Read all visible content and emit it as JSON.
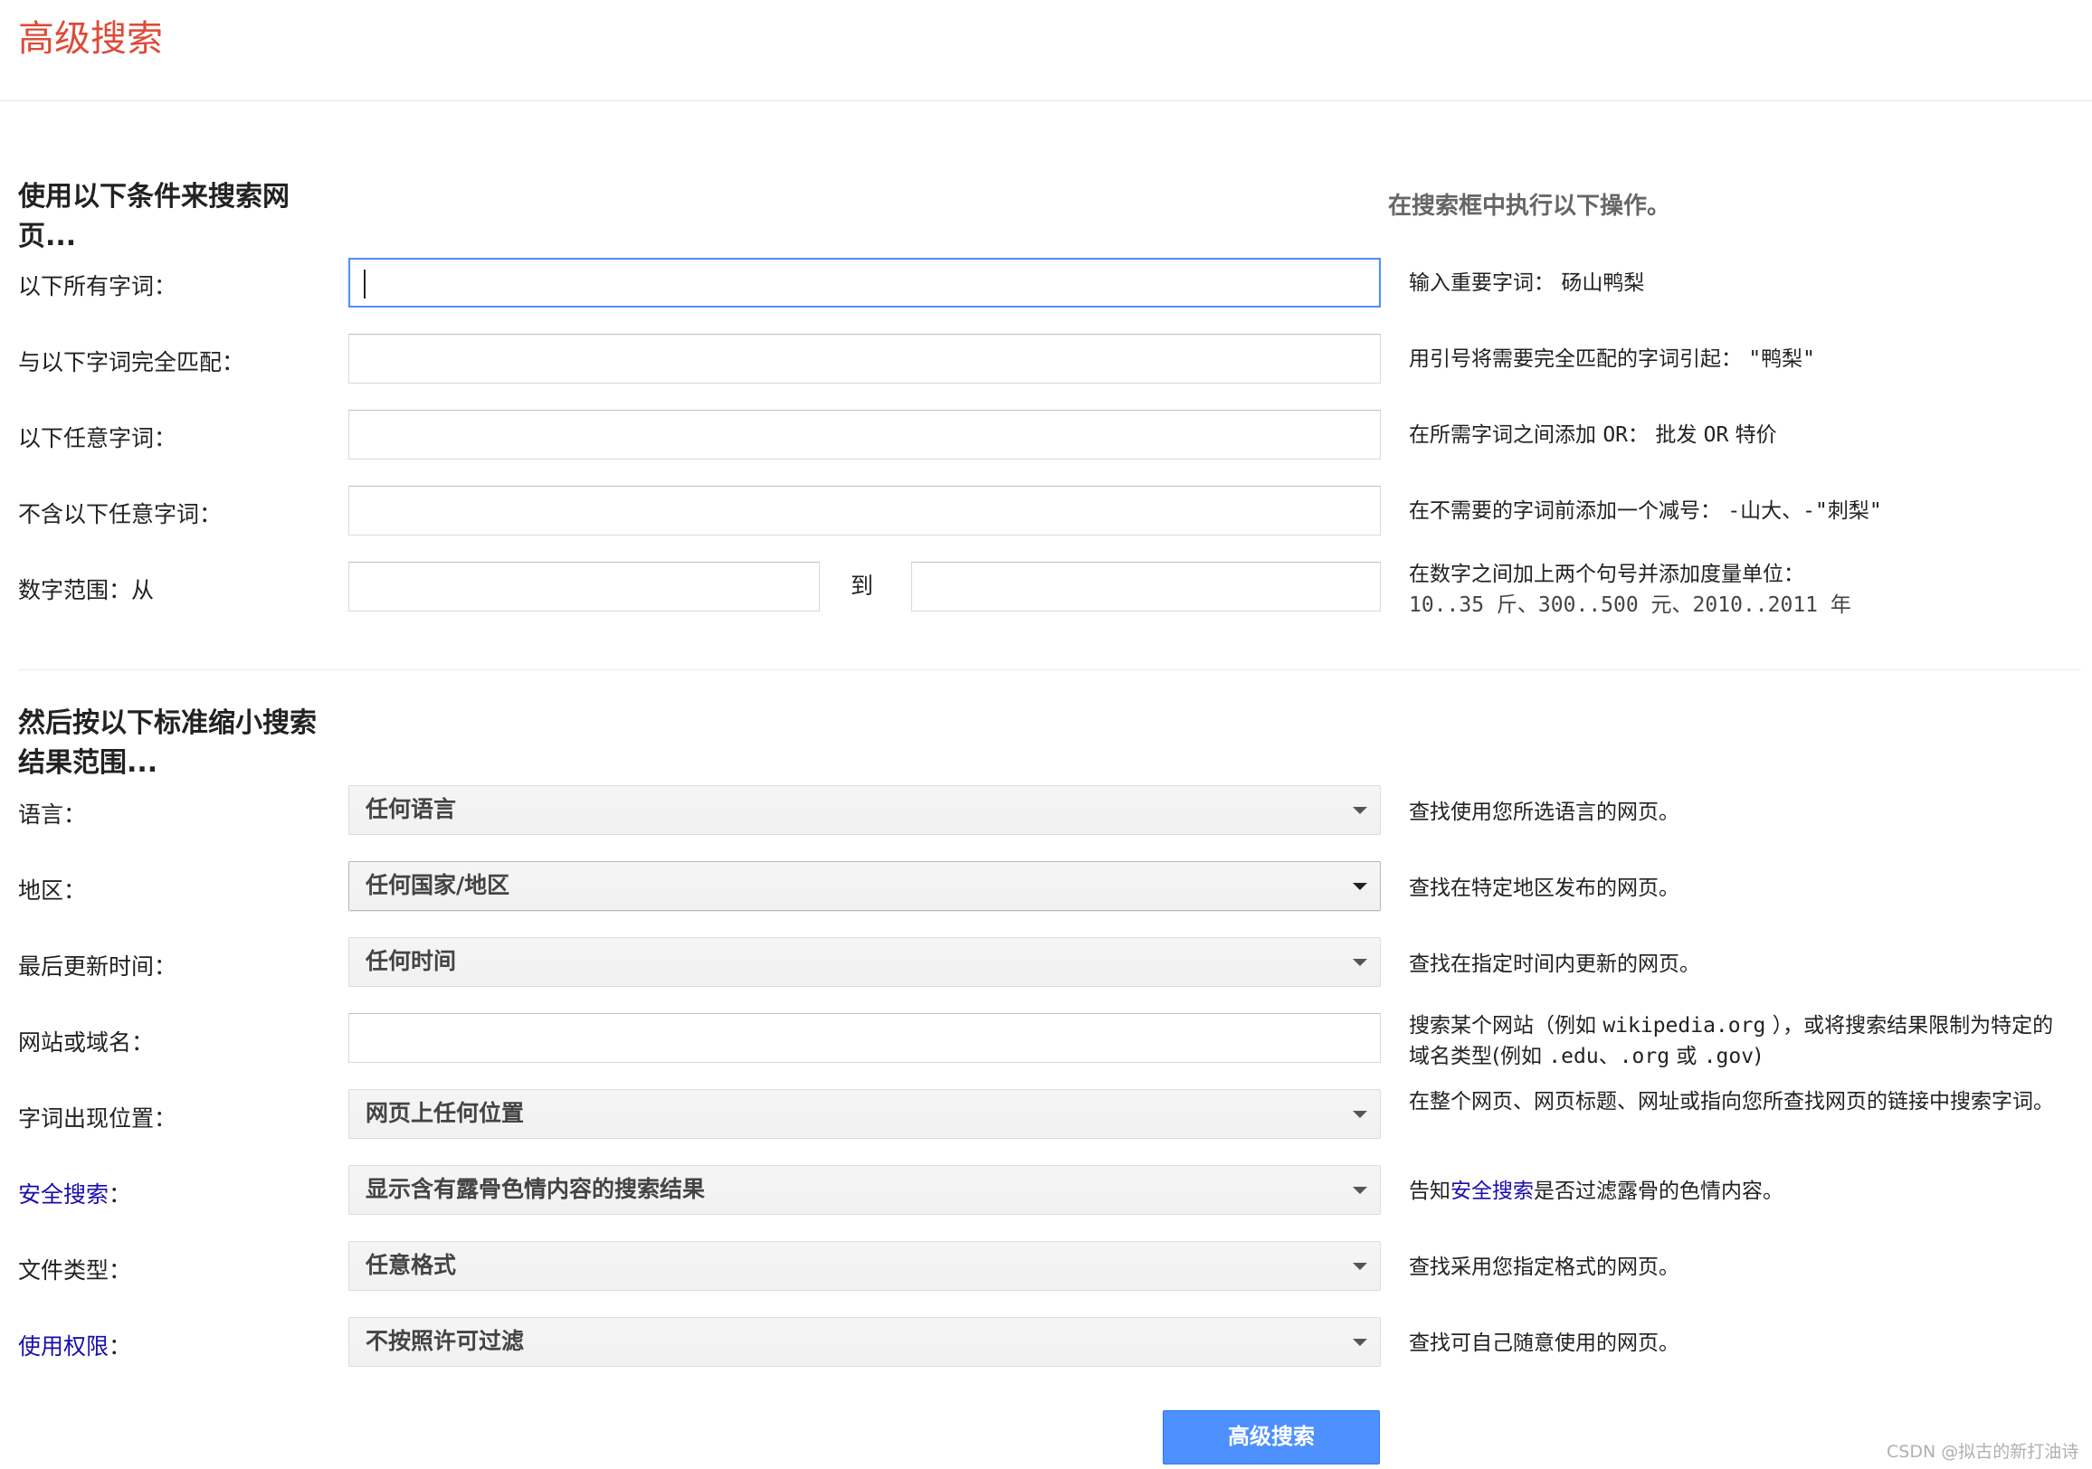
{
  "page": {
    "title": "高级搜索",
    "right_heading": "在搜索框中执行以下操作。",
    "watermark": "CSDN @拟古的新打油诗"
  },
  "section1": {
    "heading": "使用以下条件来搜索网页...",
    "heading_line1": "使用以下条件来搜索网",
    "heading_line2": "页...",
    "all_words": {
      "label": "以下所有字词：",
      "value": "",
      "hint_text": "输入重要字词：",
      "hint_example": "砀山鸭梨"
    },
    "exact_phrase": {
      "label": "与以下字词完全匹配：",
      "value": "",
      "hint_text": "用引号将需要完全匹配的字词引起：",
      "hint_example": "\"鸭梨\""
    },
    "any_words": {
      "label": "以下任意字词：",
      "value": "",
      "hint_text": "在所需字词之间添加",
      "hint_or": "OR",
      "hint_colon": "：",
      "hint_ex1": "批发",
      "hint_or2": "OR",
      "hint_ex2": "特价"
    },
    "none_words": {
      "label": "不含以下任意字词：",
      "value": "",
      "hint_text": "在不需要的字词前添加一个减号：",
      "hint_example": "-山大、-\"刺梨\""
    },
    "number_range": {
      "label": "数字范围：从",
      "to_label": "到",
      "from_value": "",
      "to_value": "",
      "hint_line1": "在数字之间加上两个句号并添加度量单位：",
      "hint_line2": "10..35 斤、300..500 元、2010..2011 年"
    }
  },
  "section2": {
    "heading_line1": "然后按以下标准缩小搜索",
    "heading_line2": "结果范围...",
    "language": {
      "label": "语言：",
      "selected": "任何语言",
      "hint": "查找使用您所选语言的网页。"
    },
    "region": {
      "label": "地区：",
      "selected": "任何国家/地区",
      "hint": "查找在特定地区发布的网页。"
    },
    "last_update": {
      "label": "最后更新时间：",
      "selected": "任何时间",
      "hint": "查找在指定时间内更新的网页。"
    },
    "site_domain": {
      "label": "网站或域名：",
      "value": "",
      "hint_a": "搜索某个网站（例如",
      "hint_site": "wikipedia.org",
      "hint_b": "），或将搜索结果限制为特定的域名类型(例如",
      "hint_edu": ".edu",
      "hint_sep": "、",
      "hint_org": ".org",
      "hint_or": "或",
      "hint_gov": ".gov",
      "hint_end": ")"
    },
    "terms_appearing": {
      "label": "字词出现位置：",
      "selected": "网页上任何位置",
      "hint": "在整个网页、网页标题、网址或指向您所查找网页的链接中搜索字词。"
    },
    "safesearch": {
      "label_link": "安全搜索",
      "label_suffix": "：",
      "selected": "显示含有露骨色情内容的搜索结果",
      "hint_a": "告知",
      "hint_link": "安全搜索",
      "hint_b": "是否过滤露骨的色情内容。"
    },
    "file_type": {
      "label": "文件类型：",
      "selected": "任意格式",
      "hint": "查找采用您指定格式的网页。"
    },
    "usage_rights": {
      "label_link": "使用权限",
      "label_suffix": "：",
      "selected": "不按照许可过滤",
      "hint": "查找可自己随意使用的网页。"
    }
  },
  "submit": {
    "label": "高级搜索"
  },
  "colors": {
    "title": "#dd4b39",
    "link": "#1a0dab",
    "button": "#4d90fe",
    "focus_border": "#4d90fe"
  }
}
